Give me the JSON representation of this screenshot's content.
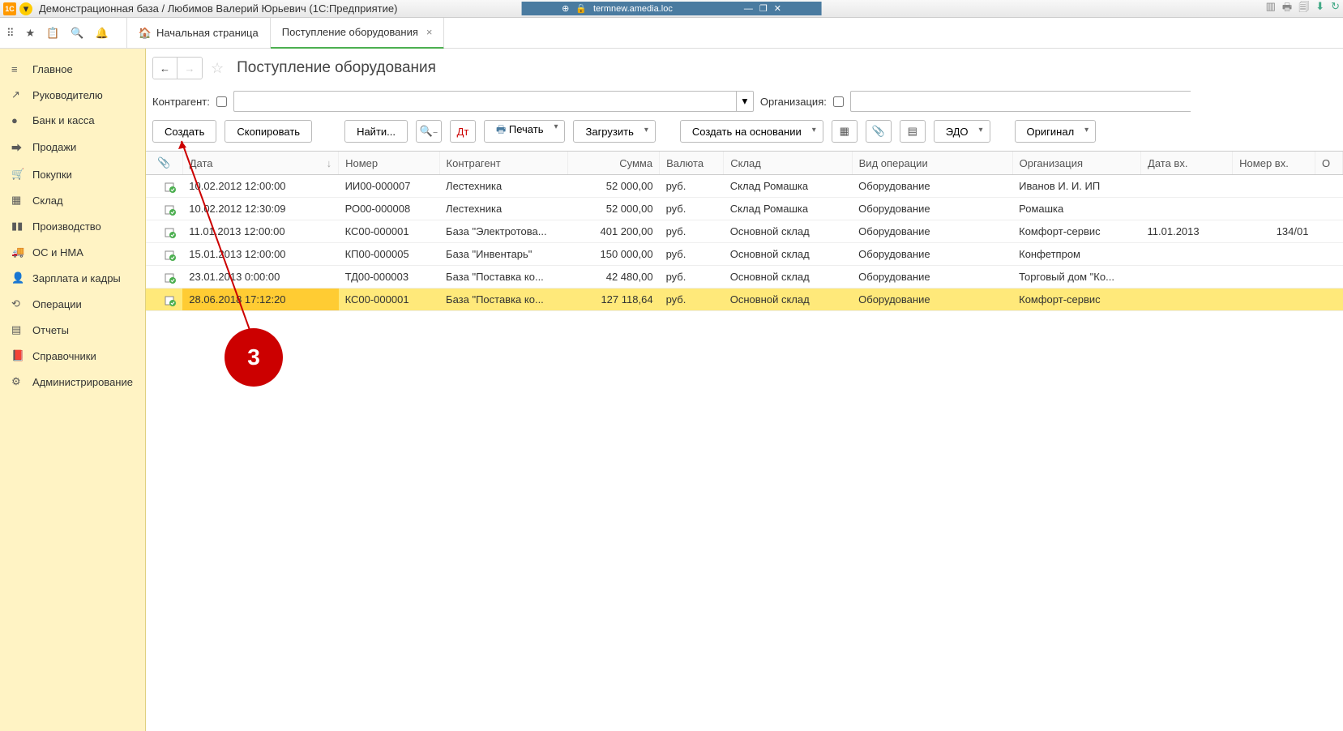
{
  "title_bar": {
    "text": "Демонстрационная база / Любимов Валерий Юрьевич  (1С:Предприятие)",
    "server": "termnew.amedia.loc"
  },
  "tabs": {
    "home": "Начальная страница",
    "active": "Поступление оборудования"
  },
  "sidebar": {
    "items": [
      {
        "icon": "≡",
        "label": "Главное"
      },
      {
        "icon": "↗",
        "label": "Руководителю"
      },
      {
        "icon": "●",
        "label": "Банк и касса"
      },
      {
        "icon": "⮕",
        "label": "Продажи"
      },
      {
        "icon": "🛒",
        "label": "Покупки"
      },
      {
        "icon": "▦",
        "label": "Склад"
      },
      {
        "icon": "▮▮",
        "label": "Производство"
      },
      {
        "icon": "🚚",
        "label": "ОС и НМА"
      },
      {
        "icon": "👤",
        "label": "Зарплата и кадры"
      },
      {
        "icon": "⟲",
        "label": "Операции"
      },
      {
        "icon": "▤",
        "label": "Отчеты"
      },
      {
        "icon": "📕",
        "label": "Справочники"
      },
      {
        "icon": "⚙",
        "label": "Администрирование"
      }
    ]
  },
  "page": {
    "title": "Поступление оборудования",
    "filter": {
      "contractor_label": "Контрагент:",
      "organization_label": "Организация:"
    },
    "toolbar": {
      "create": "Создать",
      "copy": "Скопировать",
      "find": "Найти...",
      "print": "Печать",
      "load": "Загрузить",
      "create_based": "Создать на основании",
      "edo": "ЭДО",
      "original": "Оригинал"
    },
    "table": {
      "headers": {
        "attach": "⌀",
        "date": "Дата",
        "number": "Номер",
        "contractor": "Контрагент",
        "sum": "Сумма",
        "currency": "Валюта",
        "warehouse": "Склад",
        "op_type": "Вид операции",
        "organization": "Организация",
        "date_in": "Дата вх.",
        "number_in": "Номер вх.",
        "last": "О"
      },
      "rows": [
        {
          "date": "10.02.2012 12:00:00",
          "number": "ИИ00-000007",
          "contractor": "Лестехника",
          "sum": "52 000,00",
          "currency": "руб.",
          "warehouse": "Склад Ромашка",
          "op_type": "Оборудование",
          "organization": "Иванов И. И. ИП",
          "date_in": "",
          "number_in": ""
        },
        {
          "date": "10.02.2012 12:30:09",
          "number": "РО00-000008",
          "contractor": "Лестехника",
          "sum": "52 000,00",
          "currency": "руб.",
          "warehouse": "Склад Ромашка",
          "op_type": "Оборудование",
          "organization": "Ромашка",
          "date_in": "",
          "number_in": ""
        },
        {
          "date": "11.01.2013 12:00:00",
          "number": "КС00-000001",
          "contractor": "База \"Электротова...",
          "sum": "401 200,00",
          "currency": "руб.",
          "warehouse": "Основной склад",
          "op_type": "Оборудование",
          "organization": "Комфорт-сервис",
          "date_in": "11.01.2013",
          "number_in": "134/01"
        },
        {
          "date": "15.01.2013 12:00:00",
          "number": "КП00-000005",
          "contractor": "База \"Инвентарь\"",
          "sum": "150 000,00",
          "currency": "руб.",
          "warehouse": "Основной склад",
          "op_type": "Оборудование",
          "organization": "Конфетпром",
          "date_in": "",
          "number_in": ""
        },
        {
          "date": "23.01.2013 0:00:00",
          "number": "ТД00-000003",
          "contractor": "База \"Поставка ко...",
          "sum": "42 480,00",
          "currency": "руб.",
          "warehouse": "Основной склад",
          "op_type": "Оборудование",
          "organization": "Торговый дом \"Ко...",
          "date_in": "",
          "number_in": ""
        },
        {
          "date": "28.06.2018 17:12:20",
          "number": "КС00-000001",
          "contractor": "База \"Поставка ко...",
          "sum": "127 118,64",
          "currency": "руб.",
          "warehouse": "Основной склад",
          "op_type": "Оборудование",
          "organization": "Комфорт-сервис",
          "date_in": "",
          "number_in": "",
          "selected": true
        }
      ]
    }
  },
  "annotation": {
    "label": "3"
  }
}
